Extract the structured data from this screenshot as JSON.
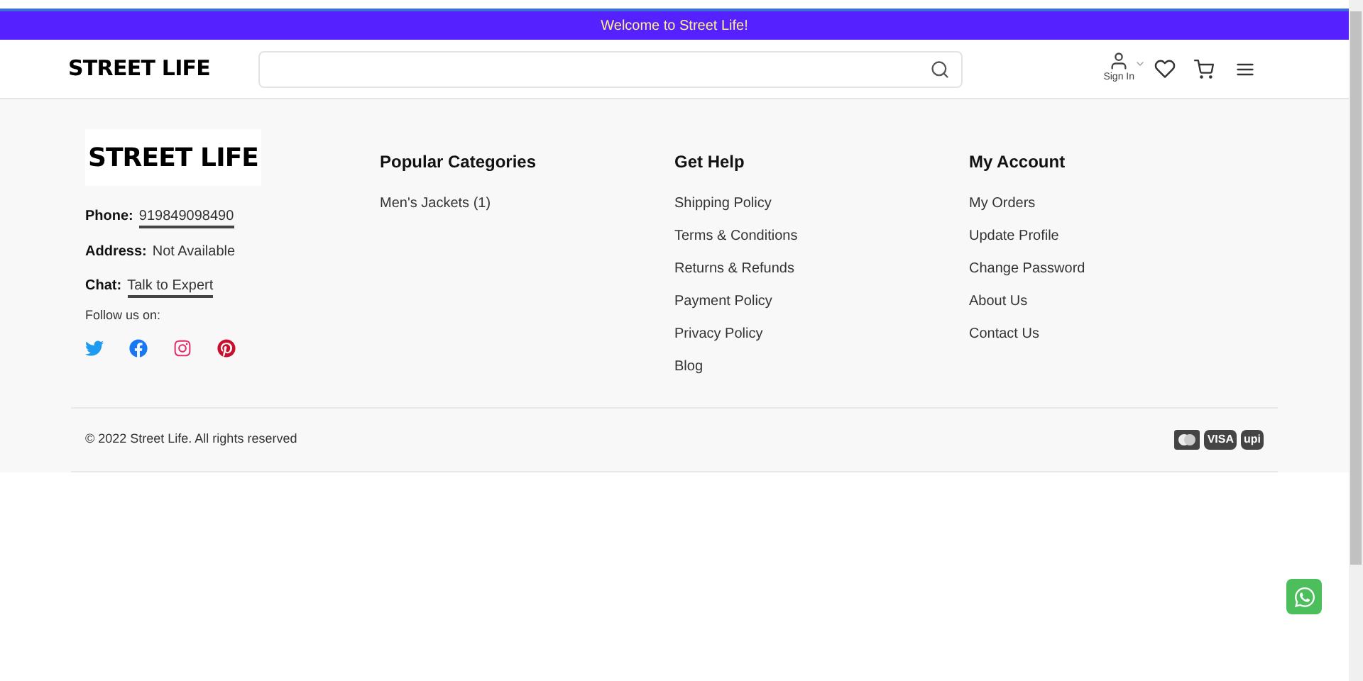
{
  "banner": {
    "text": "Welcome to Street Life!"
  },
  "header": {
    "logo": "STREET LIFE",
    "sign_in": "Sign In"
  },
  "footer": {
    "logo": "STREET LIFE",
    "contact": [
      {
        "label": "Phone:",
        "value": "919849098490",
        "kind": "link"
      },
      {
        "label": "Address:",
        "value": "Not Available",
        "kind": "text"
      },
      {
        "label": "Chat:",
        "value": "Talk to Expert",
        "kind": "link"
      }
    ],
    "follow": "Follow us on:",
    "columns": [
      {
        "title": "Popular Categories",
        "links": [
          "Men's Jackets (1)"
        ]
      },
      {
        "title": "Get Help",
        "links": [
          "Shipping Policy",
          "Terms & Conditions",
          "Returns & Refunds",
          "Payment Policy",
          "Privacy Policy",
          "Blog"
        ]
      },
      {
        "title": "My Account",
        "links": [
          "My Orders",
          "Update Profile",
          "Change Password",
          "About Us",
          "Contact Us"
        ]
      }
    ],
    "copyright": "© 2022 Street Life. All rights reserved",
    "payments": [
      "VISA",
      "upi"
    ]
  }
}
